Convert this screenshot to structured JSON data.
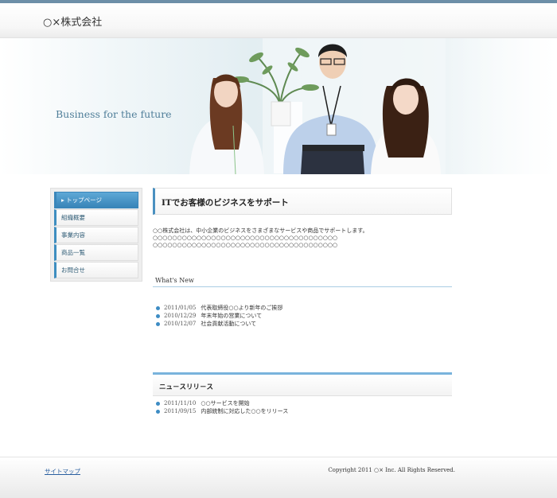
{
  "header": {
    "logo": "○×株式会社"
  },
  "hero": {
    "tagline": "Business for the future"
  },
  "sidebar": {
    "items": [
      {
        "label": "▸ トップページ",
        "active": true
      },
      {
        "label": "組織概要"
      },
      {
        "label": "事業内容"
      },
      {
        "label": "商品一覧"
      },
      {
        "label": "お問合せ"
      }
    ]
  },
  "main": {
    "heading": "ITでお客様のビジネスをサポート",
    "intro": "○○株式会社は、中小企業のビジネスをさまざまなサービスや商品でサポートします。\n○○○○○○○○○○○○○○○○○○○○○○○○○○○○○○○○○○○○○○\n○○○○○○○○○○○○○○○○○○○○○○○○○○○○○○○○○○○○○○",
    "whats_new_title": "What's New",
    "whats_new": [
      {
        "date": "2011/01/05",
        "text": "代表取締役○○より新年のご挨拶"
      },
      {
        "date": "2010/12/29",
        "text": "年末年始の営業について"
      },
      {
        "date": "2010/12/07",
        "text": "社会貢献活動について"
      }
    ],
    "press_title": "ニュ－スリリ－ス",
    "press": [
      {
        "date": "2011/11/10",
        "text": "○○サービスを開始"
      },
      {
        "date": "2011/09/15",
        "text": "内部統制に対応した○○をリリース"
      }
    ]
  },
  "footer": {
    "sitemap": "サイトマップ",
    "copyright": "Copyright 2011 ○× Inc. All Rights Reserved."
  }
}
